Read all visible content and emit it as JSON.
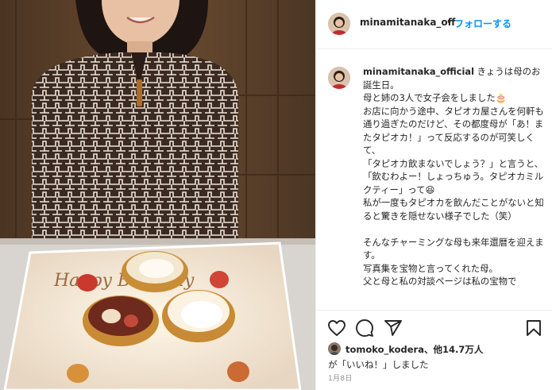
{
  "post": {
    "image_alt": "",
    "plate_text": "Happy Birthday"
  },
  "header": {
    "username": "minamitanaka_off",
    "separator": "•",
    "follow_label": "フォローする"
  },
  "caption": {
    "username": "minamitanaka_official",
    "text": " きょうは母のお誕生日。\n母と姉の3人で女子会をしました🎂\nお店に向かう途中、タピオカ屋さんを何軒も通り過ぎたのだけど、その都度母が「あ！またタピオカ！」って反応するのが可笑しくて、\n「タピオカ飲まないでしょう？」と言うと、\n「飲むわよー！しょっちゅう。タピオカミルクティー」って😆\n私が一度もタピオカを飲んだことがないと知ると驚きを隠せない様子でした（笑）\n\nそんなチャーミングな母も来年還暦を迎えます。\n写真集を宝物と言ってくれた母。\n父と母と私の対談ページは私の宝物で"
  },
  "actions": {
    "like_icon": "heart-icon",
    "comment_icon": "comment-icon",
    "share_icon": "share-icon",
    "save_icon": "bookmark-icon"
  },
  "likes": {
    "user": "tomoko_kodera",
    "others": "、他14.7万人",
    "suffix": "が「いいね！」しました"
  },
  "date": "1月8日"
}
